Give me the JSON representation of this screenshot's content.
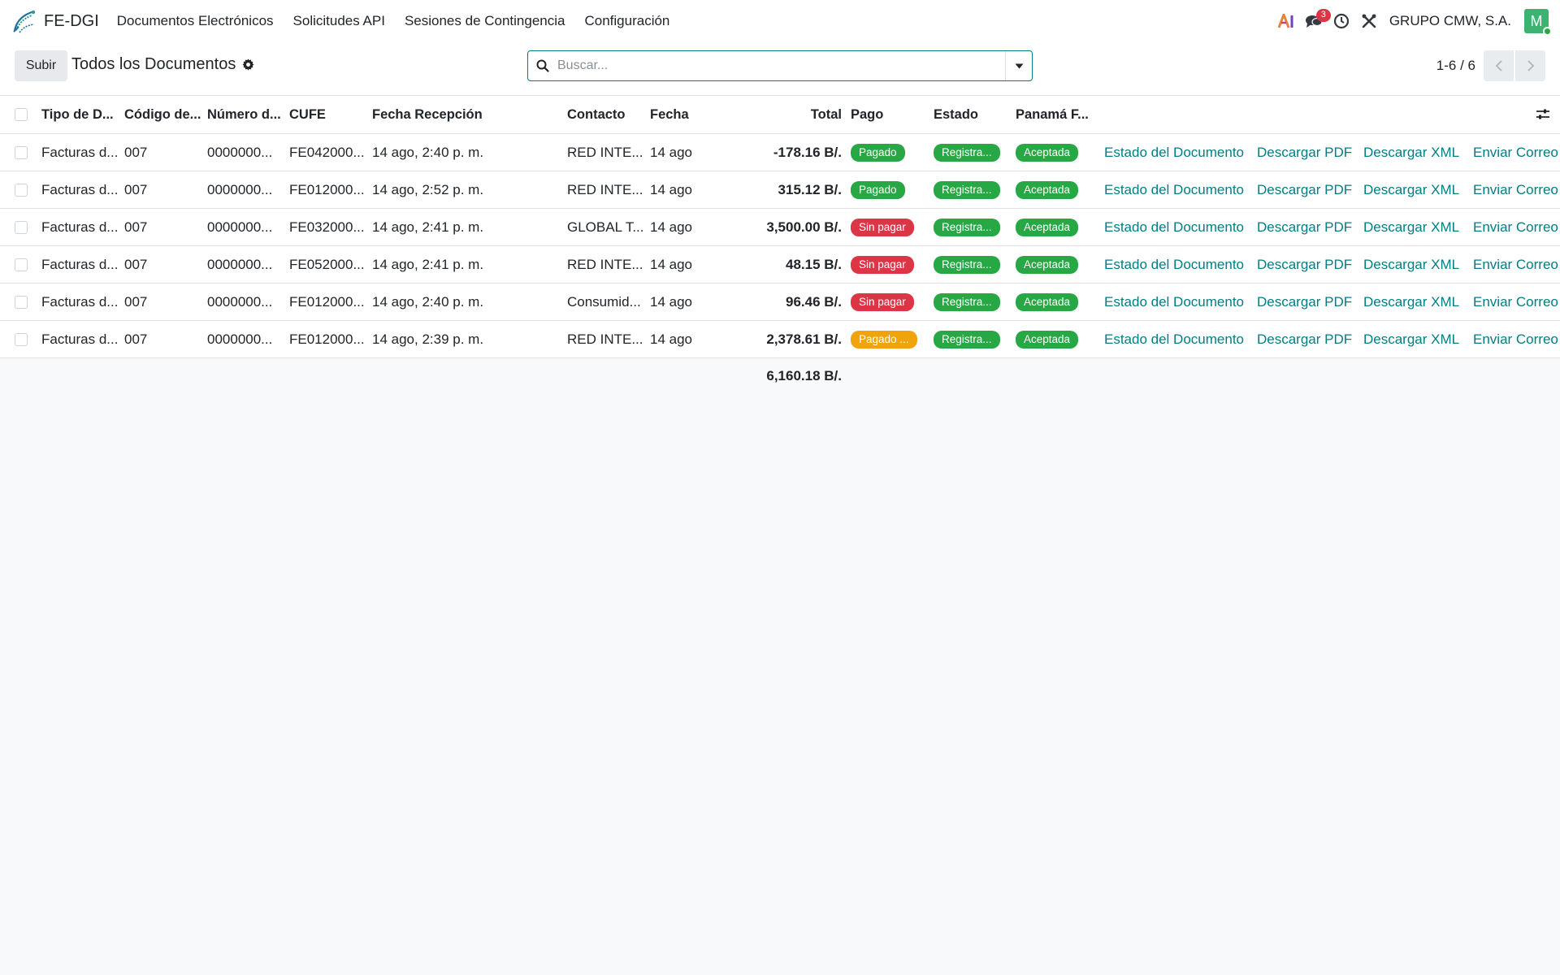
{
  "app": {
    "name": "FE-DGI",
    "menu": [
      "Documentos Electrónicos",
      "Solicitudes API",
      "Sesiones de Contingencia",
      "Configuración"
    ],
    "chat_count": "3",
    "company": "GRUPO CMW, S.A.",
    "avatar_letter": "M"
  },
  "control": {
    "upload_label": "Subir",
    "view_title": "Todos los Documentos",
    "search_placeholder": "Buscar...",
    "pager": "1-6 / 6"
  },
  "table": {
    "headers": {
      "tipo": "Tipo de D...",
      "codigo": "Código de...",
      "numero": "Número d...",
      "cufe": "CUFE",
      "recepcion": "Fecha Recepción",
      "contacto": "Contacto",
      "fecha": "Fecha",
      "total": "Total",
      "pago": "Pago",
      "estado": "Estado",
      "panama": "Panamá F..."
    },
    "actions": [
      "Estado del Documento",
      "Descargar PDF",
      "Descargar XML",
      "Enviar Correo"
    ],
    "rows": [
      {
        "tipo": "Facturas d...",
        "codigo": "007",
        "numero": "0000000...",
        "cufe": "FE042000...",
        "recepcion": "14 ago, 2:40 p. m.",
        "contacto": "RED INTE...",
        "fecha": "14 ago",
        "total": "-178.16 B/.",
        "pago": "Pagado",
        "pago_color": "#28a745",
        "estado": "Registra...",
        "panama": "Aceptada"
      },
      {
        "tipo": "Facturas d...",
        "codigo": "007",
        "numero": "0000000...",
        "cufe": "FE012000...",
        "recepcion": "14 ago, 2:52 p. m.",
        "contacto": "RED INTE...",
        "fecha": "14 ago",
        "total": "315.12 B/.",
        "pago": "Pagado",
        "pago_color": "#28a745",
        "estado": "Registra...",
        "panama": "Aceptada"
      },
      {
        "tipo": "Facturas d...",
        "codigo": "007",
        "numero": "0000000...",
        "cufe": "FE032000...",
        "recepcion": "14 ago, 2:41 p. m.",
        "contacto": "GLOBAL T...",
        "fecha": "14 ago",
        "total": "3,500.00 B/.",
        "pago": "Sin pagar",
        "pago_color": "#dc3545",
        "estado": "Registra...",
        "panama": "Aceptada"
      },
      {
        "tipo": "Facturas d...",
        "codigo": "007",
        "numero": "0000000...",
        "cufe": "FE052000...",
        "recepcion": "14 ago, 2:41 p. m.",
        "contacto": "RED INTE...",
        "fecha": "14 ago",
        "total": "48.15 B/.",
        "pago": "Sin pagar",
        "pago_color": "#dc3545",
        "estado": "Registra...",
        "panama": "Aceptada"
      },
      {
        "tipo": "Facturas d...",
        "codigo": "007",
        "numero": "0000000...",
        "cufe": "FE012000...",
        "recepcion": "14 ago, 2:40 p. m.",
        "contacto": "Consumid...",
        "fecha": "14 ago",
        "total": "96.46 B/.",
        "pago": "Sin pagar",
        "pago_color": "#dc3545",
        "estado": "Registra...",
        "panama": "Aceptada"
      },
      {
        "tipo": "Facturas d...",
        "codigo": "007",
        "numero": "0000000...",
        "cufe": "FE012000...",
        "recepcion": "14 ago, 2:39 p. m.",
        "contacto": "RED INTE...",
        "fecha": "14 ago",
        "total": "2,378.61 B/.",
        "pago": "Pagado ...",
        "pago_color": "#f0a30a",
        "estado": "Registra...",
        "panama": "Aceptada"
      }
    ],
    "grand_total": "6,160.18 B/."
  },
  "colors": {
    "accent": "#017e84",
    "success": "#28a745",
    "danger": "#dc3545",
    "warning": "#f0a30a"
  },
  "icons": {
    "brand": "fe-dgi-logo",
    "ai": "ai-icon",
    "chat": "chat-icon",
    "activity": "clock-icon",
    "tools": "tools-icon",
    "gear": "gear-icon",
    "search": "search-icon",
    "dropdown": "caret-down-icon",
    "pager_prev": "chevron-left-icon",
    "pager_next": "chevron-right-icon",
    "optional_columns": "sliders-icon"
  }
}
